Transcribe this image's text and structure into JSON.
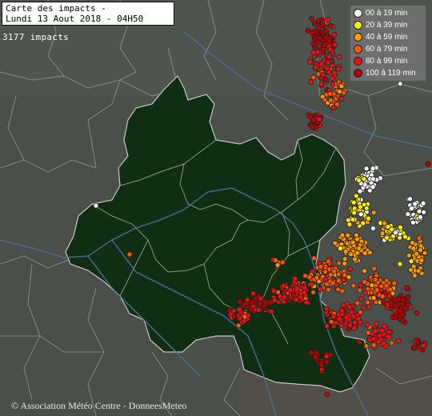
{
  "map": {
    "title_line1": "Carte des impacts -",
    "title_line2": "Lundi 13 Aout 2018 - 04H50",
    "impact_count": "3177 impacts",
    "copyright": "© Association Météo Centre - DonneesMeteo",
    "colors": {
      "background": "#4a4f4a",
      "region_fill": "#0f2e12",
      "border": "#9aa09a",
      "river": "#4f6f99"
    },
    "legend": [
      {
        "label": "00 à 19 min",
        "color": "#ffffff"
      },
      {
        "label": "20 à 39 min",
        "color": "#ffee00"
      },
      {
        "label": "40 à 59 min",
        "color": "#ff9900"
      },
      {
        "label": "60 à 79 min",
        "color": "#ff5a00"
      },
      {
        "label": "80 à 99 min",
        "color": "#ee1111"
      },
      {
        "label": "100 à 119 min",
        "color": "#bb0000"
      }
    ]
  }
}
